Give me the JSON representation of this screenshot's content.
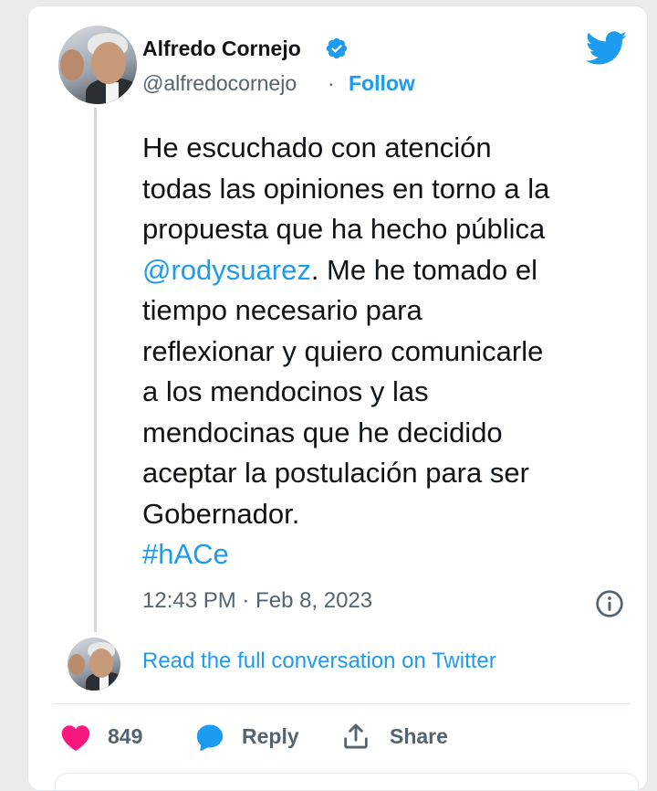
{
  "author": {
    "name": "Alfredo Cornejo",
    "handle": "@alfredocornejo",
    "separator": "·",
    "follow_label": "Follow"
  },
  "tweet": {
    "lines": [
      "He escuchado con atención",
      "todas las opiniones en torno a la",
      "propuesta que ha hecho pública",
      "",
      "tiempo necesario para",
      "reflexionar y quiero comunicarle",
      "a los mendocinos y las",
      "mendocinas que he decidido",
      "aceptar la postulación para ser",
      "Gobernador."
    ],
    "mention": "@rodysuarez",
    "after_mention": ". Me he tomado el",
    "hashtag": "#hACe",
    "timestamp": "12:43 PM · Feb 8, 2023"
  },
  "conversation": {
    "read_full_label": "Read the full conversation on Twitter"
  },
  "actions": {
    "like_count": "849",
    "reply_label": "Reply",
    "share_label": "Share"
  },
  "icons": {
    "verified": "verified-badge-icon",
    "twitter": "twitter-bird-icon",
    "info": "info-icon",
    "heart": "heart-icon",
    "reply": "reply-bubble-icon",
    "share": "share-icon"
  },
  "colors": {
    "twitter_blue": "#1d9bf0",
    "text_primary": "#0f1419",
    "text_secondary": "#536471",
    "heart_pink": "#f91880",
    "thread_line": "#cfd9de"
  }
}
